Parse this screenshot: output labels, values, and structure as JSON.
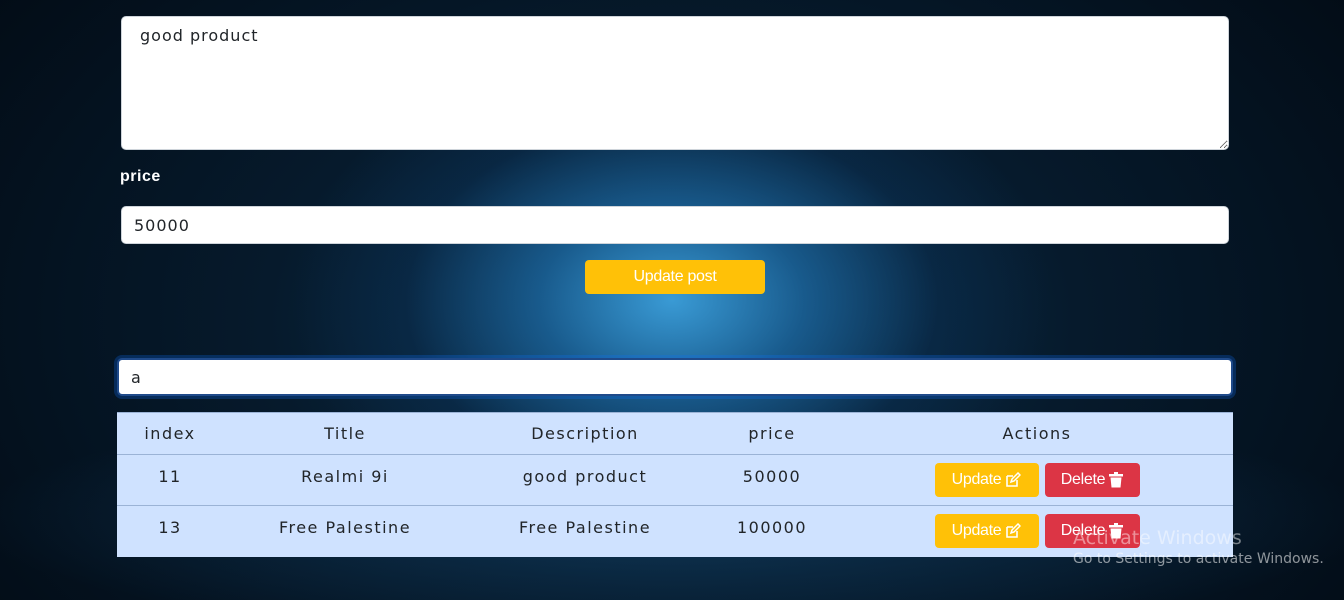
{
  "form": {
    "description_value": "good product",
    "price_label": "price",
    "price_value": "50000",
    "update_post_label": "Update post"
  },
  "search": {
    "value": "a"
  },
  "table": {
    "headers": [
      "index",
      "Title",
      "Description",
      "price",
      "Actions"
    ],
    "rows": [
      {
        "index": "11",
        "title": "Realmi 9i",
        "description": "good product",
        "price": "50000"
      },
      {
        "index": "13",
        "title": "Free Palestine",
        "description": "Free Palestine",
        "price": "100000"
      }
    ],
    "update_label": "Update",
    "delete_label": "Delete"
  },
  "icons": {
    "update": "edit-icon",
    "delete": "trash-icon"
  },
  "colors": {
    "warning": "#ffc107",
    "danger": "#dc3545",
    "table_bg": "#cfe2ff"
  },
  "watermark": {
    "title": "Activate Windows",
    "subtitle": "Go to Settings to activate Windows."
  }
}
